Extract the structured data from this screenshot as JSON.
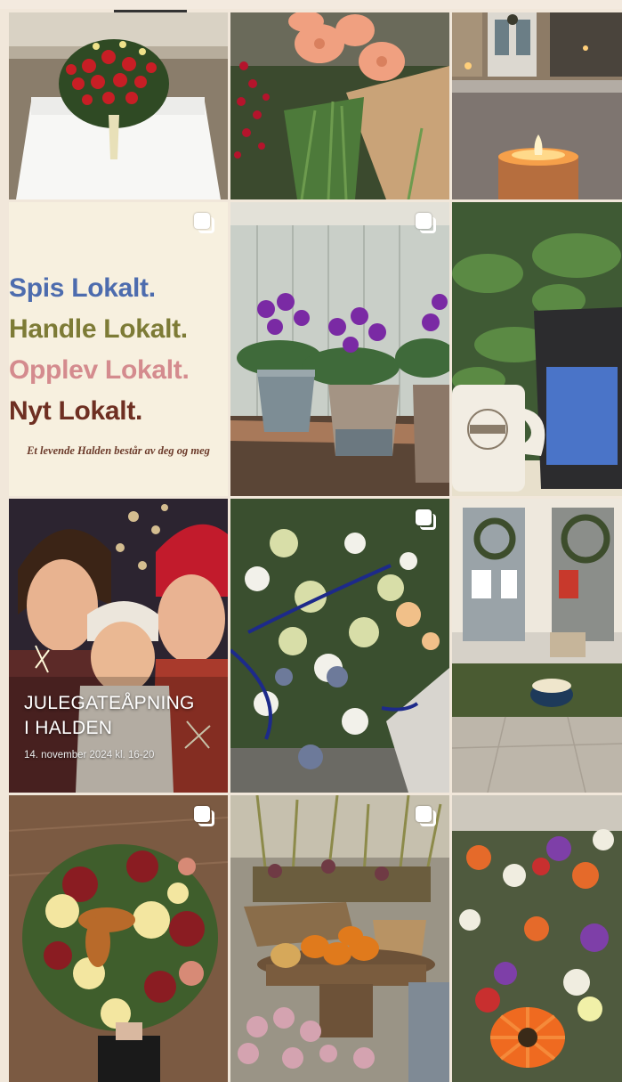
{
  "poster": {
    "line1": "Spis Lokalt.",
    "line2": "Handle Lokalt.",
    "line3": "Opplev Lokalt.",
    "line4": "Nyt Lokalt.",
    "tagline": "Et levende Halden består av deg og meg"
  },
  "event": {
    "title_line1": "JULEGATEÅPNING",
    "title_line2": "I HALDEN",
    "date": "14. november 2024 kl. 16-20"
  },
  "colors": {
    "line1": "#4d6cae",
    "line2": "#7d7b36",
    "line3": "#d48b8e",
    "line4": "#6e2f22"
  },
  "icons": {
    "multi_post": "carousel-icon"
  }
}
